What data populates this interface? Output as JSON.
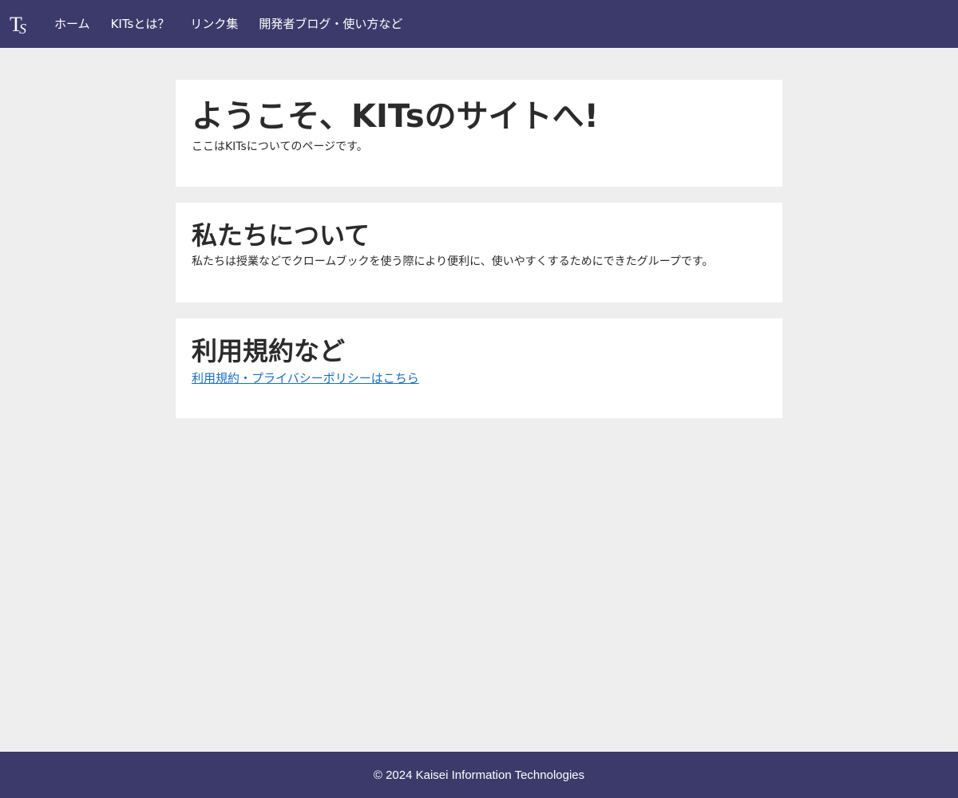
{
  "colors": {
    "nav_background": "#3c3a6b",
    "page_background": "#eeeeee",
    "card_background": "#ffffff",
    "text": "#2b2b2b",
    "link": "#1a6fc2"
  },
  "header": {
    "logo_icon": "kits-logo-icon",
    "nav": [
      {
        "label": "ホーム"
      },
      {
        "label": "KITsとは？"
      },
      {
        "label": "リンク集"
      },
      {
        "label": "開発者ブログ・使い方など"
      }
    ]
  },
  "main": {
    "welcome": {
      "title": "ようこそ、KITsのサイトへ!",
      "text": "ここはKITsについてのページです。"
    },
    "about": {
      "title": "私たちについて",
      "text": "私たちは授業などでクロームブックを使う際により便利に、使いやすくするためにできたグループです。"
    },
    "terms": {
      "title": "利用規約など",
      "link_text": "利用規約・プライバシーポリシーはこちら"
    }
  },
  "footer": {
    "copyright": "© 2024 Kaisei Information Technologies"
  }
}
